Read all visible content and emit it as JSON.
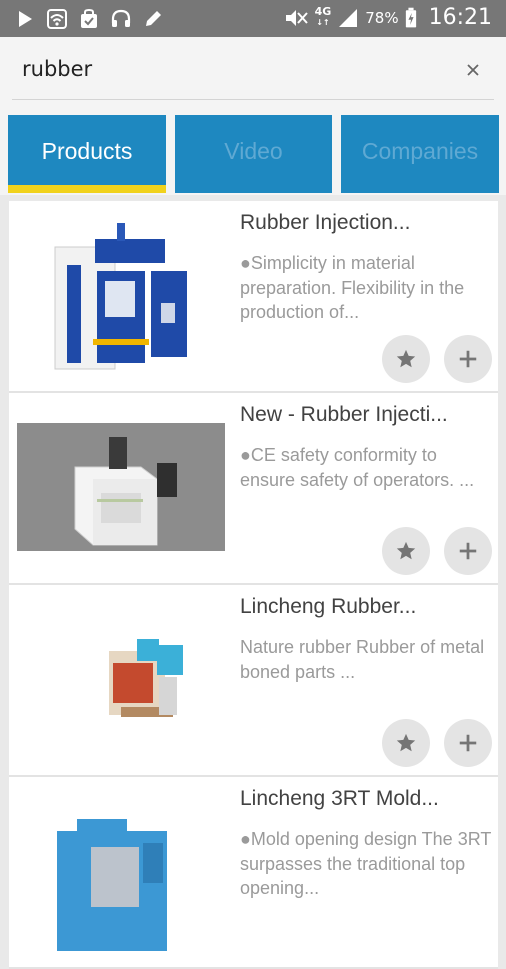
{
  "status_bar": {
    "network": "4G",
    "battery": "78%",
    "time": "16:21"
  },
  "search": {
    "query": "rubber",
    "clear_icon": "close-icon"
  },
  "tabs": [
    {
      "label": "Products",
      "active": true
    },
    {
      "label": "Video",
      "active": false
    },
    {
      "label": "Companies",
      "active": false
    }
  ],
  "products": [
    {
      "title": "Rubber Injection...",
      "description": "●Simplicity in material preparation. Flexibility in the production of..."
    },
    {
      "title": "New - Rubber Injecti...",
      "description": "●CE safety conformity to ensure safety of operators. ..."
    },
    {
      "title": "Lincheng Rubber...",
      "description": " Nature rubber  Rubber of metal boned parts ..."
    },
    {
      "title": "Lincheng 3RT Mold...",
      "description": "●Mold opening design The 3RT surpasses the traditional top opening..."
    }
  ],
  "colors": {
    "status_bar": "#777777",
    "tab_bg": "#1e88c0",
    "tab_indicator": "#f1d21c"
  }
}
